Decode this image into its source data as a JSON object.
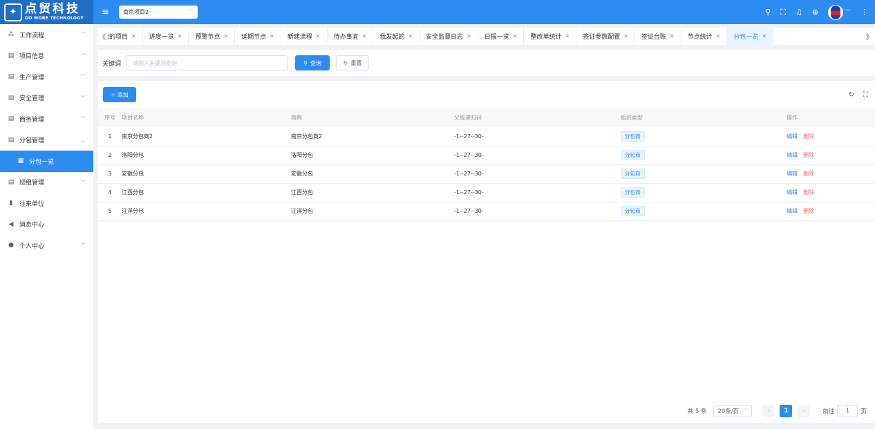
{
  "brand": {
    "name_cn": "点贸科技",
    "name_en": "DO MORE TECHNOLOGY"
  },
  "header": {
    "project_select": "南京项目2",
    "icons": [
      "search-icon",
      "fullscreen-icon",
      "bell-icon",
      "globe-icon",
      "avatar",
      "chevron-down-icon",
      "more-vertical-icon"
    ]
  },
  "sidebar": {
    "items": [
      {
        "label": "工作流程",
        "icon": "workflow-icon",
        "arrow": "﹀"
      },
      {
        "label": "项目信息",
        "icon": "document-icon",
        "arrow": "﹀"
      },
      {
        "label": "生产管理",
        "icon": "document-icon",
        "arrow": "﹀"
      },
      {
        "label": "安全管理",
        "icon": "document-icon",
        "arrow": "﹀"
      },
      {
        "label": "商务管理",
        "icon": "document-icon",
        "arrow": "﹀"
      },
      {
        "label": "分包管理",
        "icon": "document-icon",
        "arrow": "︿"
      },
      {
        "label": "分包一览",
        "icon": "table-icon",
        "arrow": ""
      },
      {
        "label": "班组管理",
        "icon": "document-icon",
        "arrow": "﹀"
      },
      {
        "label": "往来单位",
        "icon": "building-icon",
        "arrow": ""
      },
      {
        "label": "消息中心",
        "icon": "speaker-icon",
        "arrow": ""
      },
      {
        "label": "个人中心",
        "icon": "user-icon",
        "arrow": "﹀"
      }
    ]
  },
  "tabs": {
    "items": [
      "我的项目",
      "进度一览",
      "预警节点",
      "延期节点",
      "新建流程",
      "待办事宜",
      "我发起的",
      "安全监督日志",
      "日报一览",
      "整改单统计",
      "签证参数配置",
      "签证台账",
      "节点统计",
      "分包一览"
    ],
    "active": "分包一览"
  },
  "search": {
    "label": "关键词",
    "placeholder": "请输入关键词查询",
    "query_label": "查询",
    "reset_label": "重置"
  },
  "toolbar": {
    "add_label": "+ 添加"
  },
  "table": {
    "columns": [
      "序号",
      "项目名称",
      "简称",
      "父级递归码",
      "组织类型",
      "操作"
    ],
    "rows": [
      {
        "idx": "1",
        "name": "南京分包商2",
        "short": "南京分包商2",
        "code": "-1--27--30-",
        "type": "分包商"
      },
      {
        "idx": "2",
        "name": "洛阳分包",
        "short": "洛阳分包",
        "code": "-1--27--30-",
        "type": "分包商"
      },
      {
        "idx": "3",
        "name": "安徽分包",
        "short": "安徽分包",
        "code": "-1--27--30-",
        "type": "分包商"
      },
      {
        "idx": "4",
        "name": "江西分包",
        "short": "江西分包",
        "code": "-1--27--30-",
        "type": "分包商"
      },
      {
        "idx": "5",
        "name": "汪洋分包",
        "short": "汪洋分包",
        "code": "-1--27--30-",
        "type": "分包商"
      }
    ],
    "edit_label": "编辑",
    "delete_label": "删除"
  },
  "pagination": {
    "total": "共 5 条",
    "page_size": "20条/页",
    "current_page": "1",
    "goto_label": "前往",
    "goto_value": "1",
    "page_suffix": "页"
  },
  "colors": {
    "primary": "#2d8cf0",
    "danger": "#f56c6c",
    "sidebar_bg": "#ffffff",
    "page_bg": "#f0f2f5"
  }
}
